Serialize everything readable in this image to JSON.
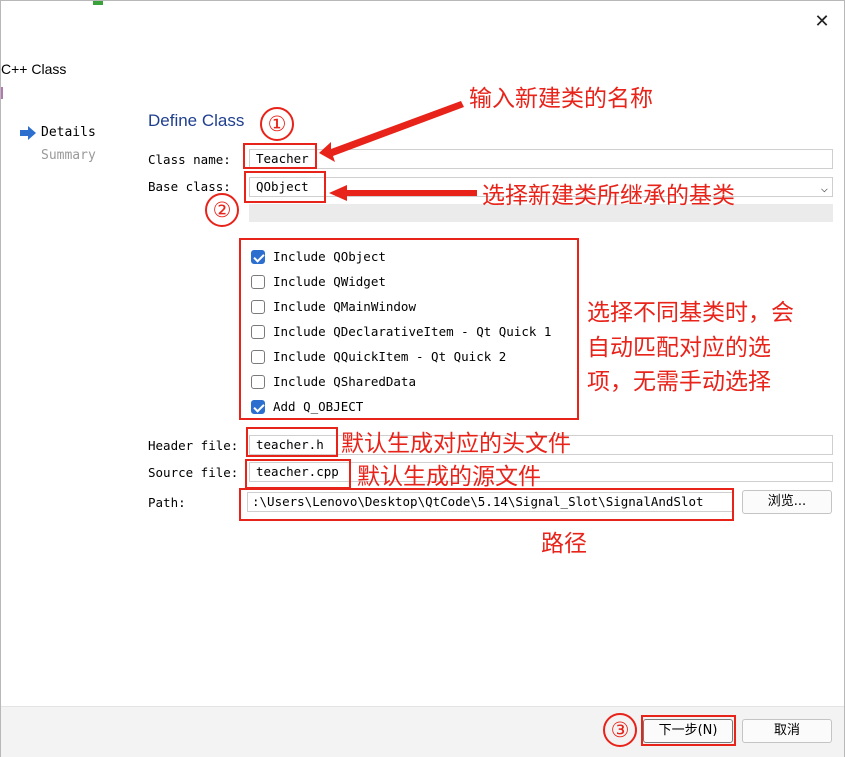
{
  "window": {
    "title": "C++ Class",
    "close_glyph": "✕"
  },
  "nav": {
    "items": [
      {
        "label": "Details",
        "active": true
      },
      {
        "label": "Summary",
        "active": false
      }
    ]
  },
  "page": {
    "title": "Define Class"
  },
  "form": {
    "class_name_label": "Class name:",
    "class_name_value": "Teacher",
    "base_class_label": "Base class:",
    "base_class_value": "QObject",
    "header_file_label": "Header file:",
    "header_file_value": "teacher.h",
    "source_file_label": "Source file:",
    "source_file_value": "teacher.cpp",
    "path_label": "Path:",
    "path_value": ":\\Users\\Lenovo\\Desktop\\QtCode\\5.14\\Signal_Slot\\SignalAndSlot",
    "browse_label": "浏览..."
  },
  "options": [
    {
      "label": "Include QObject",
      "checked": true
    },
    {
      "label": "Include QWidget",
      "checked": false
    },
    {
      "label": "Include QMainWindow",
      "checked": false
    },
    {
      "label": "Include QDeclarativeItem - Qt Quick 1",
      "checked": false
    },
    {
      "label": "Include QQuickItem - Qt Quick 2",
      "checked": false
    },
    {
      "label": "Include QSharedData",
      "checked": false
    },
    {
      "label": "Add Q_OBJECT",
      "checked": true
    }
  ],
  "footer": {
    "next_label": "下一步(N)",
    "cancel_label": "取消"
  },
  "annotations": {
    "n1": "①",
    "n2": "②",
    "n3": "③",
    "class_name_note": "输入新建类的名称",
    "base_class_note": "选择新建类所继承的基类",
    "checkbox_note_1": "选择不同基类时，会",
    "checkbox_note_2": "自动匹配对应的选",
    "checkbox_note_3": "项，无需手动选择",
    "header_note": "默认生成对应的头文件",
    "source_note": "默认生成的源文件",
    "path_note": "路径"
  },
  "colors": {
    "annotation": "#e8231a",
    "accent": "#2d6fcf",
    "title_blue": "#1f3f8f"
  },
  "icons": {
    "nav_arrow": "arrow-right-icon",
    "select_chevron": "chevron-down-icon",
    "checkbox_check": "checkmark-icon"
  }
}
